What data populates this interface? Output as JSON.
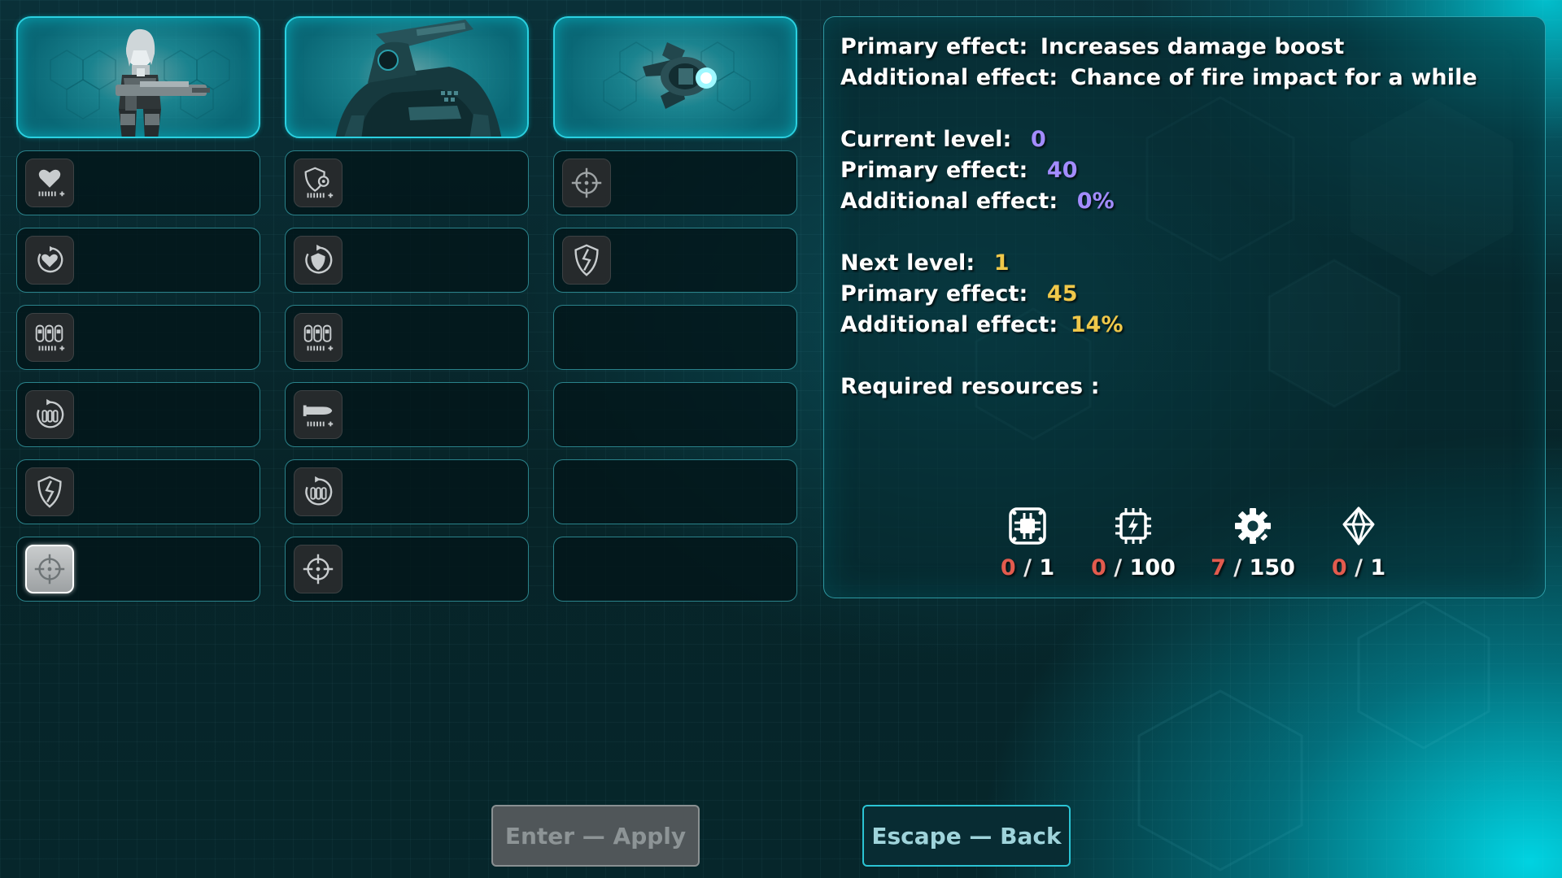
{
  "columns": [
    {
      "unit": "operative",
      "slots": [
        {
          "icon": "heart-health-plus-icon",
          "selected": false
        },
        {
          "icon": "heart-regen-icon",
          "selected": false
        },
        {
          "icon": "ammo-capacity-plus-icon",
          "selected": false
        },
        {
          "icon": "ammo-reload-icon",
          "selected": false
        },
        {
          "icon": "armor-break-icon",
          "selected": false
        },
        {
          "icon": "crosshair-icon",
          "selected": true
        }
      ]
    },
    {
      "unit": "mech",
      "slots": [
        {
          "icon": "shield-gear-plus-icon",
          "selected": false
        },
        {
          "icon": "shield-regen-icon",
          "selected": false
        },
        {
          "icon": "ammo-capacity-plus-icon",
          "selected": false
        },
        {
          "icon": "rocket-plus-icon",
          "selected": false
        },
        {
          "icon": "ammo-reload-icon",
          "selected": false
        },
        {
          "icon": "crosshair-icon",
          "selected": false
        }
      ]
    },
    {
      "unit": "drone",
      "slots": [
        {
          "icon": "crosshair-icon",
          "selected": false
        },
        {
          "icon": "armor-break-icon",
          "selected": false
        },
        {
          "icon": "",
          "selected": false
        },
        {
          "icon": "",
          "selected": false
        },
        {
          "icon": "",
          "selected": false
        },
        {
          "icon": "",
          "selected": false
        }
      ]
    }
  ],
  "info": {
    "primary_label": "Primary effect:",
    "primary_text": "Increases damage boost",
    "additional_label": "Additional effect:",
    "additional_text": "Chance of fire impact for a while",
    "current_level_label": "Current level:",
    "current_level": "0",
    "current_primary_label": "Primary effect:",
    "current_primary": "40",
    "current_additional_label": "Additional effect:",
    "current_additional": "0%",
    "next_level_label": "Next level:",
    "next_level": "1",
    "next_primary_label": "Primary effect:",
    "next_primary": "45",
    "next_additional_label": "Additional effect:",
    "next_additional": "14%",
    "required_label": "Required resources :"
  },
  "resources": [
    {
      "icon": "circuit-board-icon",
      "have": "0",
      "sep": "/",
      "need": "1"
    },
    {
      "icon": "energy-chip-icon",
      "have": "0",
      "sep": "/",
      "need": "100"
    },
    {
      "icon": "gear-icon",
      "have": "7",
      "sep": "/",
      "need": "150"
    },
    {
      "icon": "crystal-icon",
      "have": "0",
      "sep": "/",
      "need": "1"
    }
  ],
  "buttons": {
    "apply_label": "Enter — Apply",
    "back_label": "Escape — Back"
  },
  "colors": {
    "accent": "#2bd0e0",
    "level_current": "#a38cff",
    "level_next": "#f0c84a",
    "resource_lacking": "#e25b4e"
  }
}
